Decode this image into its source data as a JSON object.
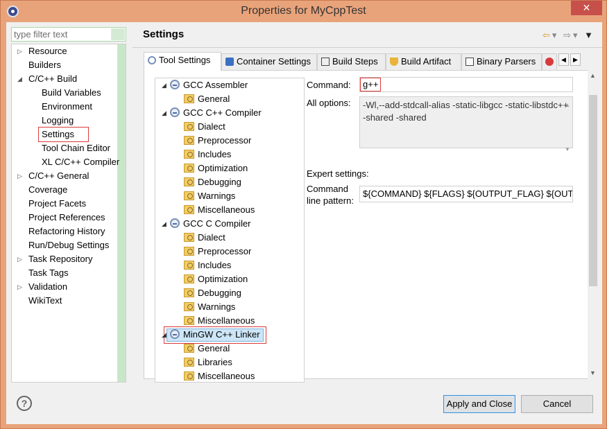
{
  "window": {
    "title": "Properties for MyCppTest",
    "close_label": "✕"
  },
  "filter": {
    "placeholder": "type filter text"
  },
  "nav": {
    "items": [
      {
        "label": "Resource",
        "expandable": true,
        "depth": 0
      },
      {
        "label": "Builders",
        "expandable": false,
        "depth": 0
      },
      {
        "label": "C/C++ Build",
        "expandable": true,
        "expanded": true,
        "depth": 0
      },
      {
        "label": "Build Variables",
        "expandable": false,
        "depth": 1
      },
      {
        "label": "Environment",
        "expandable": false,
        "depth": 1
      },
      {
        "label": "Logging",
        "expandable": false,
        "depth": 1
      },
      {
        "label": "Settings",
        "expandable": false,
        "depth": 1,
        "selected": true
      },
      {
        "label": "Tool Chain Editor",
        "expandable": false,
        "depth": 1
      },
      {
        "label": "XL C/C++ Compiler",
        "expandable": false,
        "depth": 1
      },
      {
        "label": "C/C++ General",
        "expandable": true,
        "depth": 0
      },
      {
        "label": "Coverage",
        "expandable": false,
        "depth": 0
      },
      {
        "label": "Project Facets",
        "expandable": false,
        "depth": 0
      },
      {
        "label": "Project References",
        "expandable": false,
        "depth": 0
      },
      {
        "label": "Refactoring History",
        "expandable": false,
        "depth": 0
      },
      {
        "label": "Run/Debug Settings",
        "expandable": false,
        "depth": 0
      },
      {
        "label": "Task Repository",
        "expandable": true,
        "depth": 0
      },
      {
        "label": "Task Tags",
        "expandable": false,
        "depth": 0
      },
      {
        "label": "Validation",
        "expandable": true,
        "depth": 0
      },
      {
        "label": "WikiText",
        "expandable": false,
        "depth": 0
      }
    ]
  },
  "header": {
    "title": "Settings"
  },
  "tabs": [
    {
      "label": "Tool Settings",
      "active": true,
      "icon": "tool-settings-icon"
    },
    {
      "label": "Container Settings",
      "icon": "container-icon"
    },
    {
      "label": "Build Steps",
      "icon": "build-steps-icon"
    },
    {
      "label": "Build Artifact",
      "icon": "trophy-icon"
    },
    {
      "label": "Binary Parsers",
      "icon": "binary-icon"
    }
  ],
  "tool_tree": [
    {
      "label": "GCC Assembler",
      "kind": "tool",
      "level": 0
    },
    {
      "label": "General",
      "kind": "folder",
      "level": 1
    },
    {
      "label": "GCC C++ Compiler",
      "kind": "tool",
      "level": 0
    },
    {
      "label": "Dialect",
      "kind": "folder",
      "level": 1
    },
    {
      "label": "Preprocessor",
      "kind": "folder",
      "level": 1
    },
    {
      "label": "Includes",
      "kind": "folder",
      "level": 1
    },
    {
      "label": "Optimization",
      "kind": "folder",
      "level": 1
    },
    {
      "label": "Debugging",
      "kind": "folder",
      "level": 1
    },
    {
      "label": "Warnings",
      "kind": "folder",
      "level": 1
    },
    {
      "label": "Miscellaneous",
      "kind": "folder",
      "level": 1
    },
    {
      "label": "GCC C Compiler",
      "kind": "tool",
      "level": 0
    },
    {
      "label": "Dialect",
      "kind": "folder",
      "level": 1
    },
    {
      "label": "Preprocessor",
      "kind": "folder",
      "level": 1
    },
    {
      "label": "Includes",
      "kind": "folder",
      "level": 1
    },
    {
      "label": "Optimization",
      "kind": "folder",
      "level": 1
    },
    {
      "label": "Debugging",
      "kind": "folder",
      "level": 1
    },
    {
      "label": "Warnings",
      "kind": "folder",
      "level": 1
    },
    {
      "label": "Miscellaneous",
      "kind": "folder",
      "level": 1
    },
    {
      "label": "MinGW C++ Linker",
      "kind": "tool",
      "level": 0,
      "selected": true
    },
    {
      "label": "General",
      "kind": "folder",
      "level": 1
    },
    {
      "label": "Libraries",
      "kind": "folder",
      "level": 1
    },
    {
      "label": "Miscellaneous",
      "kind": "folder",
      "level": 1
    }
  ],
  "form": {
    "command_label": "Command:",
    "command_value": "g++",
    "all_options_label": "All options:",
    "all_options_value": "-Wl,--add-stdcall-alias -static-libgcc -static-libstdc++ -shared -shared",
    "expert_label": "Expert settings:",
    "pattern_label_1": "Command",
    "pattern_label_2": "line pattern:",
    "pattern_value": "${COMMAND} ${FLAGS} ${OUTPUT_FLAG} ${OUTPUT_PREFIX}${OUTPUT} ${INPUTS}"
  },
  "buttons": {
    "apply_close": "Apply and Close",
    "cancel": "Cancel",
    "help": "?"
  }
}
